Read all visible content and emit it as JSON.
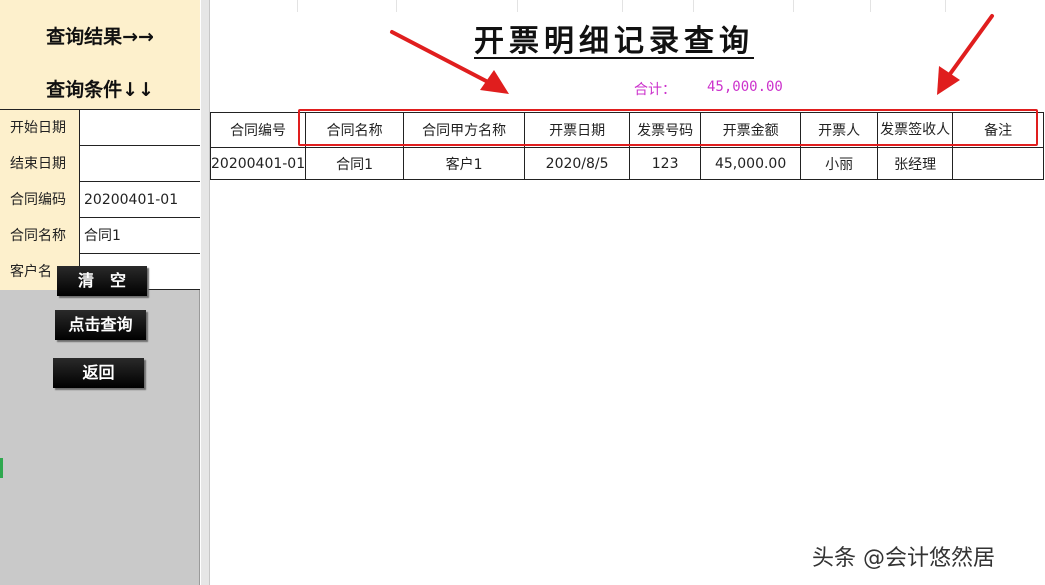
{
  "left_panel": {
    "header_line1": "查询结果→→",
    "header_line2": "查询条件↓↓",
    "conditions": [
      {
        "label": "开始日期",
        "value": ""
      },
      {
        "label": "结束日期",
        "value": ""
      },
      {
        "label": "合同编码",
        "value": "20200401-01"
      },
      {
        "label": "合同名称",
        "value": "合同1"
      },
      {
        "label": "客户名",
        "value": ""
      }
    ],
    "buttons": {
      "clear": "清　空",
      "query": "点击查询",
      "back": "返回"
    }
  },
  "sheet": {
    "title": "开票明细记录查询",
    "total_label": "合计：",
    "total_value": "45,000.00",
    "columns": [
      "合同编号",
      "合同名称",
      "合同甲方名称",
      "开票日期",
      "发票号码",
      "开票金额",
      "开票人",
      "发票签收人",
      "备注"
    ],
    "rows": [
      [
        "20200401-01",
        "合同1",
        "客户1",
        "2020/8/5",
        "123",
        "45,000.00",
        "小丽",
        "张经理",
        ""
      ]
    ]
  },
  "annotation": {
    "highlight_color": "#e01e1e"
  },
  "watermark": "头条 @会计悠然居"
}
